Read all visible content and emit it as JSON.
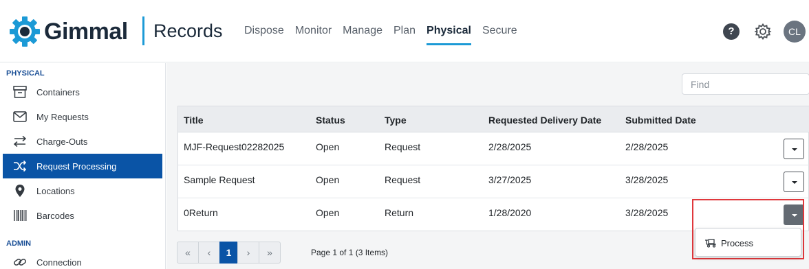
{
  "header": {
    "brand": "Gimmal",
    "app_name": "Records",
    "nav": [
      "Dispose",
      "Monitor",
      "Manage",
      "Plan",
      "Physical",
      "Secure"
    ],
    "active_nav": "Physical",
    "help_label": "?",
    "avatar_initials": "CL",
    "accent_color": "#1c9ad6"
  },
  "sidebar": {
    "section_physical": "PHYSICAL",
    "items": [
      {
        "label": "Containers",
        "icon": "archive-box-icon"
      },
      {
        "label": "My Requests",
        "icon": "envelope-icon"
      },
      {
        "label": "Charge-Outs",
        "icon": "swap-arrows-icon"
      },
      {
        "label": "Request Processing",
        "icon": "shuffle-icon",
        "active": true
      },
      {
        "label": "Locations",
        "icon": "map-pin-icon"
      },
      {
        "label": "Barcodes",
        "icon": "barcode-icon"
      }
    ],
    "section_admin": "ADMIN",
    "admin_items": [
      {
        "label": "Connection",
        "icon": "link-icon"
      }
    ]
  },
  "search": {
    "placeholder": "Find"
  },
  "table": {
    "columns": [
      "Title",
      "Status",
      "Type",
      "Requested Delivery Date",
      "Submitted Date"
    ],
    "rows": [
      {
        "title": "MJF-Request02282025",
        "status": "Open",
        "type": "Request",
        "requested_delivery_date": "2/28/2025",
        "submitted_date": "2/28/2025"
      },
      {
        "title": "Sample Request",
        "status": "Open",
        "type": "Request",
        "requested_delivery_date": "3/27/2025",
        "submitted_date": "3/28/2025"
      },
      {
        "title": "0Return",
        "status": "Open",
        "type": "Return",
        "requested_delivery_date": "1/28/2020",
        "submitted_date": "3/28/2025"
      }
    ]
  },
  "row_menu": {
    "items": [
      {
        "label": "Process",
        "icon": "dolly-icon"
      }
    ]
  },
  "pagination": {
    "first": "«",
    "prev": "‹",
    "current_page": "1",
    "next": "›",
    "last": "»",
    "info": "Page 1 of 1 (3 Items)"
  },
  "colors": {
    "sidebar_active": "#0a54a6",
    "highlight": "#e0383c"
  }
}
